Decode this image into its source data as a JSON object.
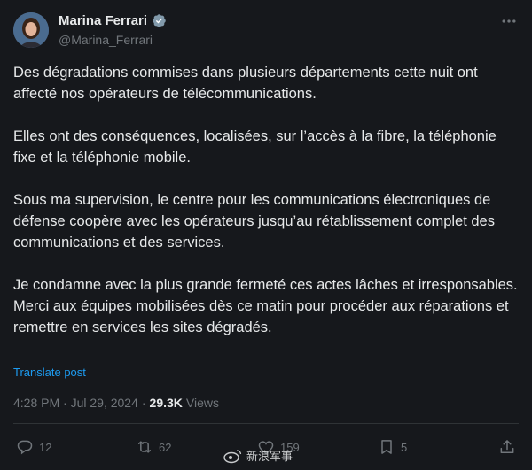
{
  "author": {
    "name": "Marina Ferrari",
    "handle": "@Marina_Ferrari"
  },
  "icons": {
    "verified": "verified-badge-icon",
    "more": "more-icon",
    "reply": "reply-icon",
    "repost": "repost-icon",
    "like": "like-icon",
    "bookmark": "bookmark-icon",
    "share": "share-icon"
  },
  "colors": {
    "background": "#16181c",
    "text": "#e7e9ea",
    "muted": "#71767b",
    "link": "#1d9bf0"
  },
  "tweet": {
    "paragraphs": [
      "Des dégradations commises dans plusieurs départements cette nuit ont affecté nos opérateurs de télécommunications.",
      "Elles ont des conséquences, localisées, sur l’accès à la fibre, la téléphonie fixe et la téléphonie mobile.",
      "Sous ma supervision, le centre pour les communications électroniques de défense coopère avec les opérateurs jusqu’au rétablissement complet des communications et des services.",
      "Je condamne avec la plus grande fermeté ces actes lâches et irresponsables.\nMerci aux équipes mobilisées dès ce matin pour procéder aux réparations et remettre en services les sites dégradés."
    ],
    "translate_label": "Translate post",
    "timestamp": "4:28 PM · Jul 29, 2024",
    "views_count": "29.3K",
    "views_label": "Views"
  },
  "actions": {
    "replies": "12",
    "reposts": "62",
    "likes": "159",
    "bookmarks": "5"
  },
  "watermark": "新浪军事"
}
